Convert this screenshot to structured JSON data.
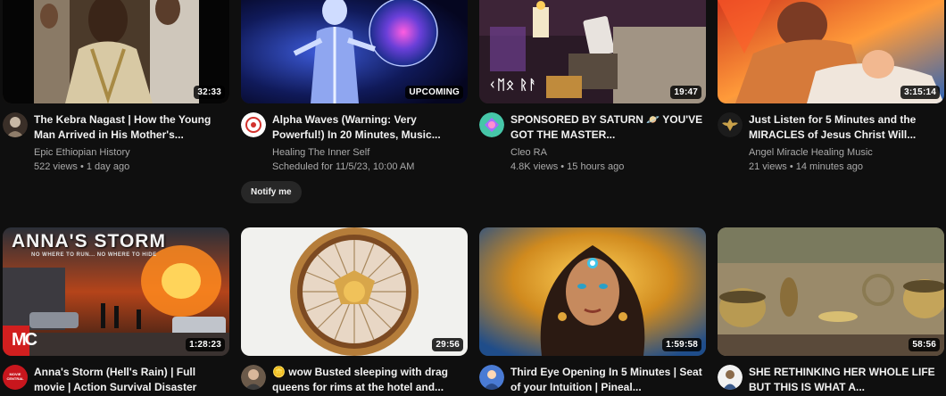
{
  "feed": {
    "videos": [
      {
        "title": "The Kebra Nagast | How the Young Man Arrived in His Mother's...",
        "channel": "Epic Ethiopian History",
        "stats": "522 views • 1 day ago",
        "badge": "32:33"
      },
      {
        "title": "Alpha Waves (Warning: Very Powerful!) In 20 Minutes, Music...",
        "channel": "Healing The Inner Self",
        "stats": "Scheduled for 11/5/23, 10:00 AM",
        "badge": "UPCOMING",
        "action_label": "Notify me"
      },
      {
        "title": "SPONSORED BY SATURN 🪐 YOU'VE GOT THE MASTER...",
        "channel": "Cleo RA",
        "stats": "4.8K views • 15 hours ago",
        "badge": "19:47",
        "thumb_text": "ᚲᛖᛟ ᚱᚨ"
      },
      {
        "title": "Just Listen for 5 Minutes and the MIRACLES of Jesus Christ Will...",
        "channel": "Angel Miracle Healing Music",
        "stats": "21 views • 14 minutes ago",
        "badge": "3:15:14"
      },
      {
        "title": "Anna's Storm (Hell's Rain) | Full movie | Action Survival Disaster",
        "badge": "1:28:23",
        "thumb_text": "ANNA'S STORM",
        "thumb_subtext": "NO WHERE TO RUN... NO WHERE TO HIDE",
        "thumb_logo": "MC",
        "avatar_text": "MOVIE CENTRAL"
      },
      {
        "title": "🪙 wow Busted sleeping with drag queens for rims at the hotel and...",
        "badge": "29:56"
      },
      {
        "title": "Third Eye Opening In 5 Minutes | Seat of your Intuition | Pineal...",
        "badge": "1:59:58"
      },
      {
        "title": "SHE RETHINKING HER WHOLE LIFE BUT THIS IS WHAT A...",
        "badge": "58:56"
      }
    ]
  },
  "colors": {
    "background": "#0f0f0f",
    "title": "#f1f1f1",
    "secondary_text": "#aaaaaa",
    "button_bg": "#272727"
  },
  "icons": [
    "channel-avatar-icon",
    "more-options-icon"
  ]
}
